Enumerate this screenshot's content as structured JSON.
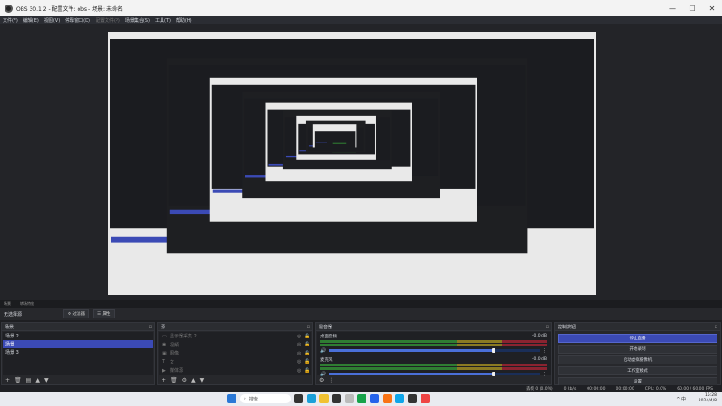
{
  "window": {
    "title": "OBS 30.1.2 - 配置文件: obs - 场景: 未命名",
    "minimize": "—",
    "maximize": "☐",
    "close": "✕"
  },
  "menu": [
    {
      "label": "文件(F)",
      "disabled": false
    },
    {
      "label": "编辑(E)",
      "disabled": false
    },
    {
      "label": "视图(V)",
      "disabled": false
    },
    {
      "label": "停靠窗口(D)",
      "disabled": false
    },
    {
      "label": "配置文件(P)",
      "disabled": true
    },
    {
      "label": "场景集合(S)",
      "disabled": false
    },
    {
      "label": "工具(T)",
      "disabled": false
    },
    {
      "label": "帮助(H)",
      "disabled": false
    }
  ],
  "tabs": [
    "场景",
    "转场特效"
  ],
  "control_row": {
    "label": "无选择源",
    "filter_btn": "过滤器",
    "properties_btn": "属性"
  },
  "scenes": {
    "title": "场景",
    "items": [
      "场景 2",
      "场景",
      "场景 3"
    ],
    "selected_index": 1
  },
  "sources": {
    "title": "源",
    "items": [
      {
        "icon": "monitor-icon",
        "glyph": "▭",
        "label": "显示器采集 2"
      },
      {
        "icon": "camera-icon",
        "glyph": "◉",
        "label": "视频"
      },
      {
        "icon": "image-icon",
        "glyph": "▣",
        "label": "图像"
      },
      {
        "icon": "text-icon",
        "glyph": "T",
        "label": "文"
      },
      {
        "icon": "media-icon",
        "glyph": "▶",
        "label": "媒体源"
      }
    ]
  },
  "mixer": {
    "title": "混音器",
    "channels": [
      {
        "name": "桌面音频",
        "db": "-0.0 dB",
        "level": 0.78
      },
      {
        "name": "麦克风",
        "db": "-0.0 dB",
        "level": 0.78
      }
    ]
  },
  "controls": {
    "title": "控制按钮",
    "buttons": [
      {
        "label": "停止直播",
        "active": true
      },
      {
        "label": "开始录制",
        "active": false
      },
      {
        "label": "启动虚拟摄像机",
        "active": false
      },
      {
        "label": "工作室模式",
        "active": false
      },
      {
        "label": "设置",
        "active": false
      }
    ]
  },
  "status": {
    "dropped": "丢帧 0 (0.0%)",
    "bitrate": "0 kb/s",
    "live_time": "00:00:00",
    "rec_time": "00:00:00",
    "cpu": "CPU: 0.0%",
    "fps": "60.00 / 60.00 FPS"
  },
  "taskbar": {
    "search_placeholder": "搜索",
    "time": "15:28",
    "date": "2024/4/8",
    "tray_text": "^ 中"
  },
  "colors": {
    "accent": "#3b4ab5",
    "meter_green": "#2f7d32",
    "meter_yellow": "#8a7a22",
    "meter_red": "#8a2330"
  }
}
